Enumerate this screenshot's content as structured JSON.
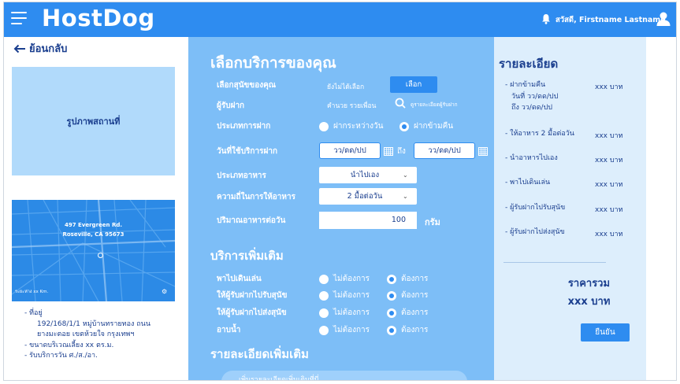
{
  "header": {
    "brand": "HostDog",
    "greeting": "สวัสดี, Firstname Lastname"
  },
  "left": {
    "back_label": "ย้อนกลับ",
    "place_image_label": "รูปภาพสถานที่",
    "map": {
      "address_line1": "497 Evergreen Rd.",
      "address_line2": "Roseville, CA 95673",
      "footer": "ระยะห่าง xx Km."
    },
    "info": {
      "address_label": "- ที่อยู่",
      "address_line1": "192/168/1/1 หมู่บ้านทรายทอง ถนน",
      "address_line2": "ยางมะตอย เขตห้วยใจ กรุงเทพฯ",
      "area": "- ขนาดบริเวณเลี้ยง xx ตร.ม.",
      "service_days": "- รับบริการวัน ศ./ส./อา."
    }
  },
  "form": {
    "title": "เลือกบริการของคุณ",
    "dog_label": "เลือกสุนัขของคุณ",
    "dog_value": "ยังไม่ได้เลือก",
    "select_button": "เลือก",
    "sitter_label": "ผู้รับฝาก",
    "sitter_value": "คำนวย รวยเพื่อน",
    "sitter_link": "ดูรายละเอียดผู้รับฝาก",
    "type_label": "ประเภทการฝาก",
    "type_options": [
      "ฝากระหว่างวัน",
      "ฝากข้ามคืน"
    ],
    "type_selected": 1,
    "date_label": "วันที่ใช้บริการฝาก",
    "date_from": "วว/ดด/ปป",
    "date_to_label": "ถึง",
    "date_to": "วว/ดด/ปป",
    "food_type_label": "ประเภทอาหาร",
    "food_type_value": "นำไปเอง",
    "freq_label": "ความถี่ในการให้อาหาร",
    "freq_value": "2 มื้อต่อวัน",
    "amount_label": "ปริมาณอาหารต่อวัน",
    "amount_value": "100",
    "amount_unit": "กรัม",
    "extra_title": "บริการเพิ่มเติม",
    "extras": [
      {
        "label": "พาไปเดินเล่น",
        "no": "ไม่ต้องการ",
        "yes": "ต้องการ",
        "selected": "yes"
      },
      {
        "label": "ให้ผู้รับฝากไปรับสุนัข",
        "no": "ไม่ต้องการ",
        "yes": "ต้องการ",
        "selected": "yes"
      },
      {
        "label": "ให้ผู้รับฝากไปส่งสุนัข",
        "no": "ไม่ต้องการ",
        "yes": "ต้องการ",
        "selected": "yes"
      },
      {
        "label": "อาบน้ำ",
        "no": "ไม่ต้องการ",
        "yes": "ต้องการ",
        "selected": "yes"
      }
    ],
    "more_title": "รายละเอียดเพิ่มเติม",
    "more_placeholder": "เพิ่มรายละเอียดเพิ่มเติมที่นี่"
  },
  "summary": {
    "title": "รายละเอียด",
    "items": [
      {
        "lines": [
          "- ฝากข้ามคืน",
          "  วันที่ วว/ดด/ปป",
          "  ถึง   วว/ดด/ปป"
        ],
        "price": "xxx บาท"
      },
      {
        "lines": [
          "- ให้อาหาร 2 มื้อต่อวัน"
        ],
        "price": "xxx บาท"
      },
      {
        "lines": [
          "- นำอาหารไปเอง"
        ],
        "price": "xxx บาท"
      },
      {
        "lines": [
          "- พาไปเดินเล่น"
        ],
        "price": "xxx บาท"
      },
      {
        "lines": [
          "- ผู้รับฝากไปรับสุนัข"
        ],
        "price": "xxx บาท"
      },
      {
        "lines": [
          "- ผู้รับฝากไปส่งสุนัข"
        ],
        "price": "xxx บาท"
      }
    ],
    "total_label": "ราคารวม",
    "total_value": "xxx บาท",
    "confirm_button": "ยืนยัน"
  },
  "colors": {
    "primary": "#2e8cf0",
    "form_panel": "#7dbef7",
    "summary_panel": "#ddeefc",
    "text_dark": "#1b3f8f"
  }
}
